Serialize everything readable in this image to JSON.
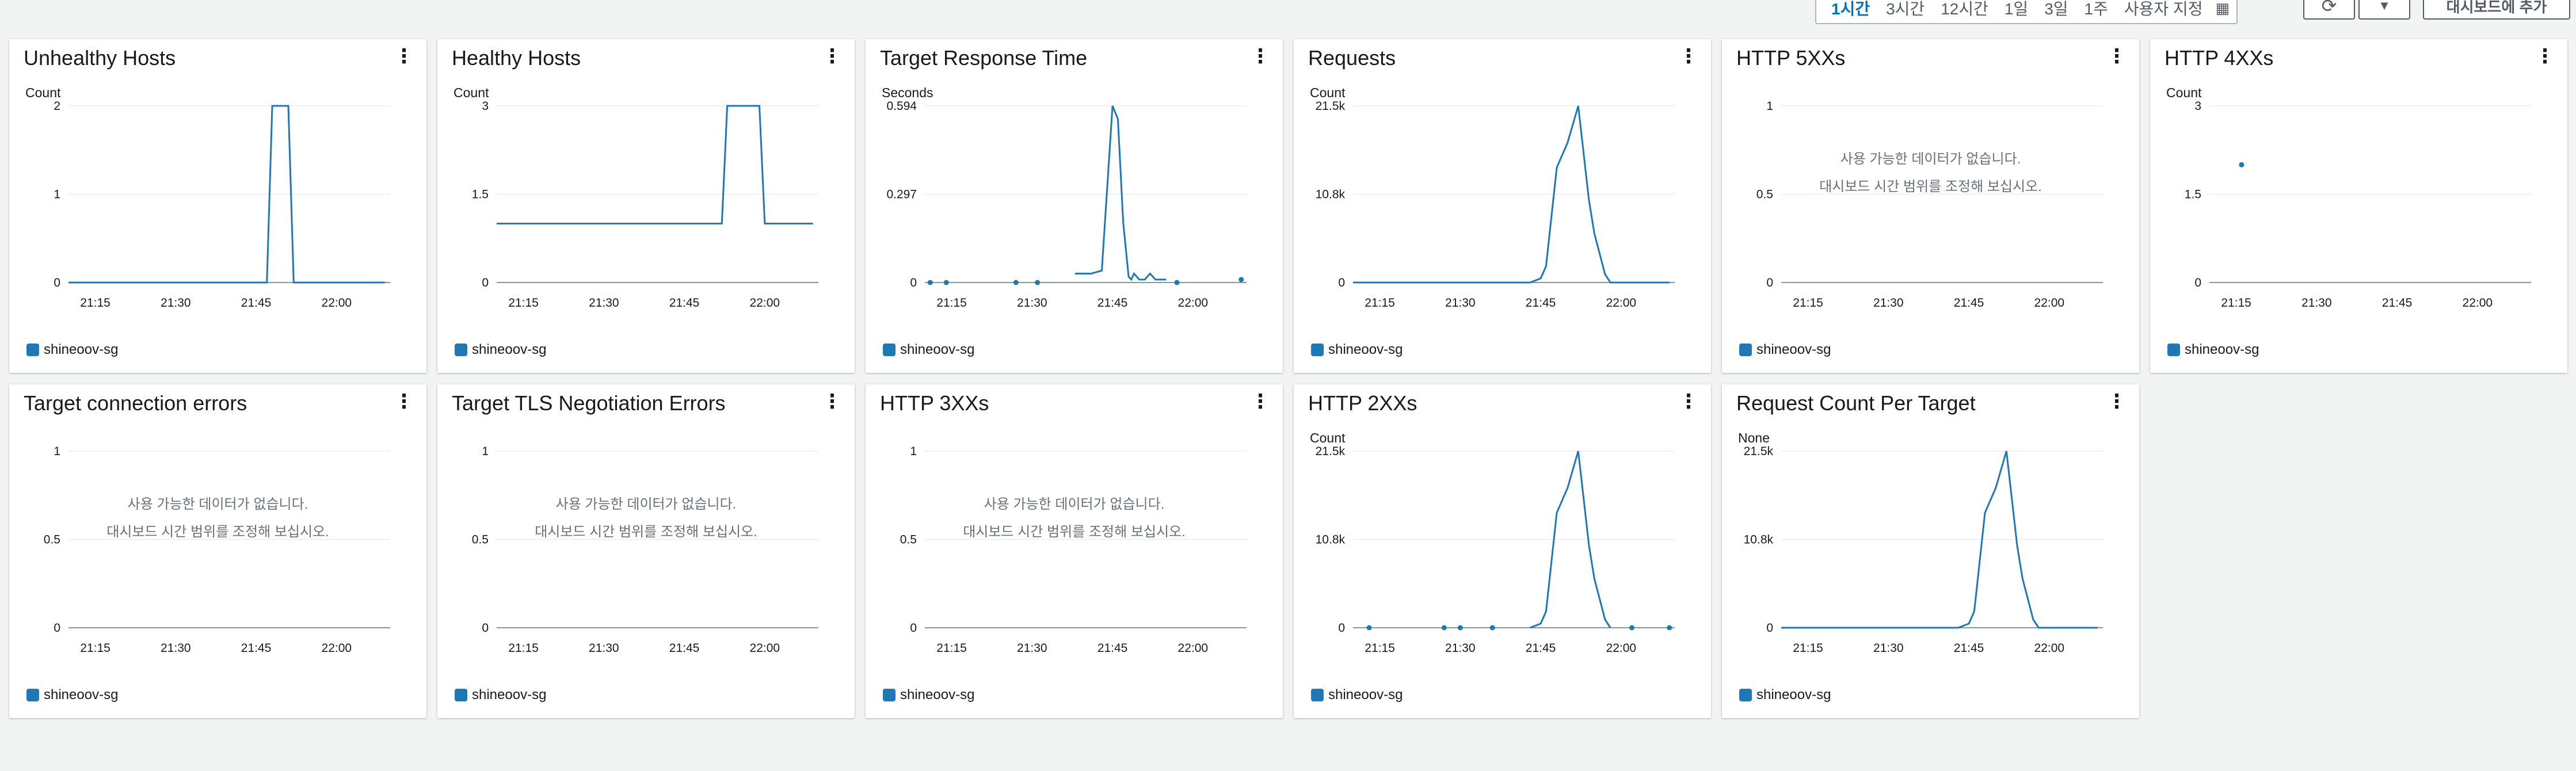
{
  "toolbar": {
    "time_ranges": [
      "1시간",
      "3시간",
      "12시간",
      "1일",
      "3일",
      "1주",
      "사용자 지정"
    ],
    "active_range": "1시간",
    "refresh_icon": "refresh-icon",
    "dropdown_icon": "caret-down-icon",
    "add_to_dashboard": "대시보드에 추가"
  },
  "no_data_message": {
    "line1": "사용 가능한 데이터가 없습니다.",
    "line2": "대시보드 시간 범위를 조정해 보십시오."
  },
  "series_color": "#1f77b4",
  "widgets": [
    {
      "title": "Unhealthy Hosts",
      "unit": "Count",
      "legend": "shineoov-sg",
      "chart_data": {
        "type": "line",
        "x_ticks": [
          "21:15",
          "21:30",
          "21:45",
          "22:00"
        ],
        "y_ticks": [
          "2",
          "1",
          "0"
        ],
        "ylim": [
          0,
          2
        ],
        "series": [
          {
            "name": "shineoov-sg",
            "x": [
              0,
              37,
              38,
              41,
              42,
              59
            ],
            "y": [
              0,
              0,
              2,
              2,
              0,
              0
            ]
          }
        ],
        "xlim": [
          0,
          60
        ]
      }
    },
    {
      "title": "Healthy Hosts",
      "unit": "Count",
      "legend": "shineoov-sg",
      "chart_data": {
        "type": "line",
        "x_ticks": [
          "21:15",
          "21:30",
          "21:45",
          "22:00"
        ],
        "y_ticks": [
          "3",
          "1.5",
          "0"
        ],
        "ylim": [
          0,
          3
        ],
        "series": [
          {
            "name": "shineoov-sg",
            "x": [
              0,
              42,
              43,
              49,
              50,
              59
            ],
            "y": [
              1,
              1,
              3,
              3,
              1,
              1
            ]
          }
        ],
        "xlim": [
          0,
          60
        ]
      }
    },
    {
      "title": "Target Response Time",
      "unit": "Seconds",
      "legend": "shineoov-sg",
      "chart_data": {
        "type": "line",
        "x_ticks": [
          "21:15",
          "21:30",
          "21:45",
          "22:00"
        ],
        "y_ticks": [
          "0.594",
          "0.297",
          "0"
        ],
        "ylim": [
          0,
          0.594
        ],
        "series": [
          {
            "name": "shineoov-sg",
            "x": [
              28,
              31,
              33,
              35,
              36,
              37,
              38,
              38.5,
              39,
              40,
              41,
              42,
              43,
              44,
              45
            ],
            "y": [
              0.03,
              0.03,
              0.04,
              0.594,
              0.55,
              0.2,
              0.02,
              0.01,
              0.03,
              0.01,
              0.01,
              0.03,
              0.01,
              0.01,
              0.01
            ]
          }
        ],
        "points": [
          [
            1,
            0
          ],
          [
            4,
            0
          ],
          [
            17,
            0
          ],
          [
            21,
            0
          ],
          [
            47,
            0
          ],
          [
            59,
            0.01
          ]
        ],
        "xlim": [
          0,
          60
        ]
      }
    },
    {
      "title": "Requests",
      "unit": "Count",
      "legend": "shineoov-sg",
      "chart_data": {
        "type": "line",
        "x_ticks": [
          "21:15",
          "21:30",
          "21:45",
          "22:00"
        ],
        "y_ticks": [
          "21.5k",
          "10.8k",
          "0"
        ],
        "ylim": [
          0,
          21500
        ],
        "series": [
          {
            "name": "shineoov-sg",
            "x": [
              0,
              33,
              35,
              36,
              38,
              40,
              42,
              44,
              45,
              47,
              48,
              59
            ],
            "y": [
              0,
              0,
              500,
              2000,
              14000,
              17000,
              21500,
              10000,
              6000,
              1000,
              0,
              0
            ]
          }
        ],
        "xlim": [
          0,
          60
        ]
      }
    },
    {
      "title": "HTTP 5XXs",
      "unit": "",
      "legend": "shineoov-sg",
      "no_data": true,
      "chart_data": {
        "type": "line",
        "x_ticks": [
          "21:15",
          "21:30",
          "21:45",
          "22:00"
        ],
        "y_ticks": [
          "1",
          "0.5",
          "0"
        ],
        "ylim": [
          0,
          1
        ],
        "series": [],
        "xlim": [
          0,
          60
        ]
      }
    },
    {
      "title": "HTTP 4XXs",
      "unit": "Count",
      "legend": "shineoov-sg",
      "chart_data": {
        "type": "scatter",
        "x_ticks": [
          "21:15",
          "21:30",
          "21:45",
          "22:00"
        ],
        "y_ticks": [
          "3",
          "1.5",
          "0"
        ],
        "ylim": [
          0,
          3
        ],
        "series": [],
        "points": [
          [
            6,
            2
          ]
        ],
        "xlim": [
          0,
          60
        ]
      }
    },
    {
      "title": "Target connection errors",
      "unit": "",
      "legend": "shineoov-sg",
      "no_data": true,
      "chart_data": {
        "type": "line",
        "x_ticks": [
          "21:15",
          "21:30",
          "21:45",
          "22:00"
        ],
        "y_ticks": [
          "1",
          "0.5",
          "0"
        ],
        "ylim": [
          0,
          1
        ],
        "series": [],
        "xlim": [
          0,
          60
        ]
      }
    },
    {
      "title": "Target TLS Negotiation Errors",
      "unit": "",
      "legend": "shineoov-sg",
      "no_data": true,
      "chart_data": {
        "type": "line",
        "x_ticks": [
          "21:15",
          "21:30",
          "21:45",
          "22:00"
        ],
        "y_ticks": [
          "1",
          "0.5",
          "0"
        ],
        "ylim": [
          0,
          1
        ],
        "series": [],
        "xlim": [
          0,
          60
        ]
      }
    },
    {
      "title": "HTTP 3XXs",
      "unit": "",
      "legend": "shineoov-sg",
      "no_data": true,
      "chart_data": {
        "type": "line",
        "x_ticks": [
          "21:15",
          "21:30",
          "21:45",
          "22:00"
        ],
        "y_ticks": [
          "1",
          "0.5",
          "0"
        ],
        "ylim": [
          0,
          1
        ],
        "series": [],
        "xlim": [
          0,
          60
        ]
      }
    },
    {
      "title": "HTTP 2XXs",
      "unit": "Count",
      "legend": "shineoov-sg",
      "chart_data": {
        "type": "line",
        "x_ticks": [
          "21:15",
          "21:30",
          "21:45",
          "22:00"
        ],
        "y_ticks": [
          "21.5k",
          "10.8k",
          "0"
        ],
        "ylim": [
          0,
          21500
        ],
        "series": [
          {
            "name": "shineoov-sg",
            "x": [
              33,
              35,
              36,
              38,
              40,
              42,
              44,
              45,
              47,
              48
            ],
            "y": [
              0,
              500,
              2000,
              14000,
              17000,
              21500,
              10000,
              6000,
              1000,
              0
            ]
          }
        ],
        "points": [
          [
            3,
            0
          ],
          [
            17,
            0
          ],
          [
            20,
            0
          ],
          [
            26,
            0
          ],
          [
            52,
            0
          ],
          [
            59,
            0
          ]
        ],
        "xlim": [
          0,
          60
        ]
      }
    },
    {
      "title": "Request Count Per Target",
      "unit": "None",
      "legend": "shineoov-sg",
      "chart_data": {
        "type": "line",
        "x_ticks": [
          "21:15",
          "21:30",
          "21:45",
          "22:00"
        ],
        "y_ticks": [
          "21.5k",
          "10.8k",
          "0"
        ],
        "ylim": [
          0,
          21500
        ],
        "series": [
          {
            "name": "shineoov-sg",
            "x": [
              0,
              33,
              35,
              36,
              38,
              40,
              42,
              44,
              45,
              47,
              48,
              59
            ],
            "y": [
              0,
              0,
              500,
              2000,
              14000,
              17000,
              21500,
              10000,
              6000,
              1000,
              0,
              0
            ]
          }
        ],
        "xlim": [
          0,
          60
        ]
      }
    }
  ]
}
